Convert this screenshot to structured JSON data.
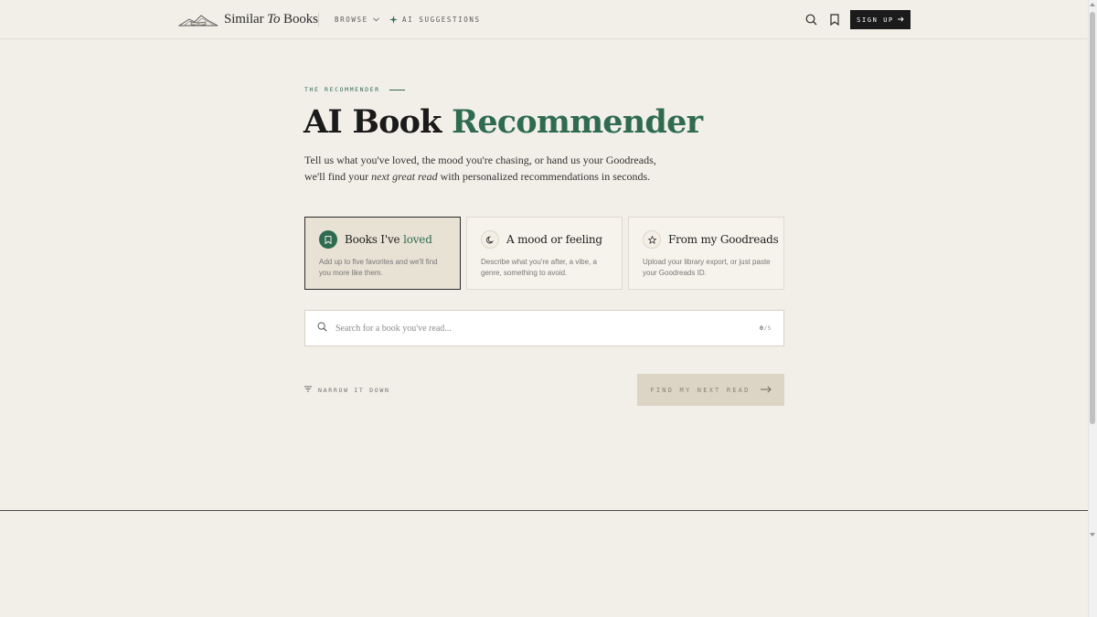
{
  "brand": {
    "name_part1": "Similar",
    "name_part2": "To",
    "name_part3": "Books"
  },
  "nav": {
    "browse_label": "BROWSE",
    "ai_label": "AI SUGGESTIONS",
    "signup_label": "SIGN UP"
  },
  "icons": {
    "logo": "book-landscape-logo-icon",
    "browse_chevron": "chevron-down-icon",
    "ai": "sparkle-icon",
    "search": "search-icon",
    "bookmark": "bookmark-icon",
    "signup_arrow": "arrow-right-icon"
  },
  "hero": {
    "eyebrow": "THE RECOMMENDER",
    "title_main": "AI Book",
    "title_accent": "Recommender",
    "lead_before": "Tell us what you've loved, the mood you're chasing, or hand us your Goodreads, we'll find your ",
    "lead_em": "next great read",
    "lead_after": " with personalized recommendations in seconds."
  },
  "modes": [
    {
      "title_main": "Books I've",
      "title_accent": "loved",
      "description": "Add up to five favorites and we'll find you more like them.",
      "icon": "bookmark-icon",
      "selected": true
    },
    {
      "title_main": "A mood or feeling",
      "title_accent": "",
      "description": "Describe what you're after, a vibe, a genre, something to avoid.",
      "icon": "moon-icon",
      "selected": false
    },
    {
      "title_main": "From my Goodreads",
      "title_accent": "",
      "description": "Upload your library export, or just paste your Goodreads ID.",
      "icon": "star-icon",
      "selected": false
    }
  ],
  "search": {
    "placeholder": "Search for a book you've read...",
    "value": "",
    "count_current": "0",
    "count_max": "/5"
  },
  "actions": {
    "narrow_label": "NARROW IT DOWN",
    "find_label": "FIND MY NEXT READ"
  },
  "colors": {
    "background": "#f2efe9",
    "accent_green": "#2f6b4f",
    "dark": "#1b1b1b",
    "find_button_bg": "#dcd4c4",
    "selected_card_bg": "#e8e2d5"
  }
}
